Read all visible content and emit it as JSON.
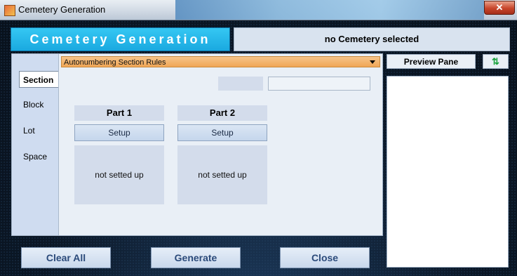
{
  "window": {
    "title": "Cemetery Generation",
    "close_glyph": "✕"
  },
  "header": {
    "banner": "Cemetery Generation",
    "selection_status": "no Cemetery selected"
  },
  "tabs": [
    {
      "label": "Section",
      "active": true
    },
    {
      "label": "Block",
      "active": false
    },
    {
      "label": "Lot",
      "active": false
    },
    {
      "label": "Space",
      "active": false
    }
  ],
  "rules_dropdown": {
    "selected": "Autonumbering Section Rules"
  },
  "parts": [
    {
      "title": "Part 1",
      "setup_label": "Setup",
      "status": "not setted up"
    },
    {
      "title": "Part 2",
      "setup_label": "Setup",
      "status": "not setted up"
    }
  ],
  "preview": {
    "label": "Preview Pane",
    "refresh_icon": "refresh-icon",
    "refresh_glyph": "⇅"
  },
  "actions": {
    "clear_all": "Clear All",
    "generate": "Generate",
    "close": "Close"
  },
  "colors": {
    "banner": "#1aa9e0",
    "dropdown": "#f0a656",
    "refresh": "#18a23c"
  }
}
